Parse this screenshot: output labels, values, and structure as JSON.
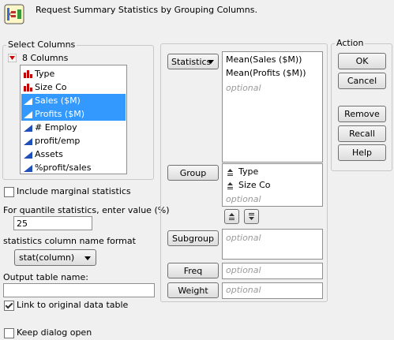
{
  "title": "Request Summary Statistics by Grouping Columns.",
  "select_columns": {
    "legend": "Select Columns",
    "count_label": "8 Columns",
    "columns": [
      {
        "label": "Type",
        "icon": "nominal-bar-icon",
        "selected": false
      },
      {
        "label": "Size Co",
        "icon": "nominal-bar-icon",
        "selected": false
      },
      {
        "label": "Sales ($M)",
        "icon": "continuous-triangle-icon",
        "selected": true
      },
      {
        "label": "Profits ($M)",
        "icon": "continuous-triangle-icon",
        "selected": true
      },
      {
        "label": "# Employ",
        "icon": "continuous-triangle-icon",
        "selected": false
      },
      {
        "label": "profit/emp",
        "icon": "continuous-triangle-icon",
        "selected": false
      },
      {
        "label": "Assets",
        "icon": "continuous-triangle-icon",
        "selected": false
      },
      {
        "label": "%profit/sales",
        "icon": "continuous-triangle-icon",
        "selected": false
      }
    ]
  },
  "options": {
    "marginal_label": "Include marginal statistics",
    "marginal_checked": false,
    "quantile_label": "For quantile statistics, enter value (%)",
    "quantile_value": "25",
    "name_format_label": "statistics column name format",
    "name_format_value": "stat(column)",
    "output_label": "Output table name:",
    "output_value": "",
    "link_label": "Link to original data table",
    "link_checked": true,
    "keep_open_label": "Keep dialog open",
    "keep_open_checked": false
  },
  "roles": {
    "statistics_button": "Statistics",
    "statistics_items": [
      "Mean(Sales ($M))",
      "Mean(Profits ($M))"
    ],
    "statistics_optional": "optional",
    "group_button": "Group",
    "group_items": [
      "Type",
      "Size Co"
    ],
    "group_optional": "optional",
    "subgroup_button": "Subgroup",
    "subgroup_optional": "optional",
    "freq_button": "Freq",
    "freq_optional": "optional",
    "weight_button": "Weight",
    "weight_optional": "optional"
  },
  "action": {
    "legend": "Action",
    "ok": "OK",
    "cancel": "Cancel",
    "remove": "Remove",
    "recall": "Recall",
    "help": "Help"
  },
  "colors": {
    "selection": "#3399ff",
    "nominal_icon": "#c00000",
    "continuous_icon": "#1f4fb8"
  }
}
